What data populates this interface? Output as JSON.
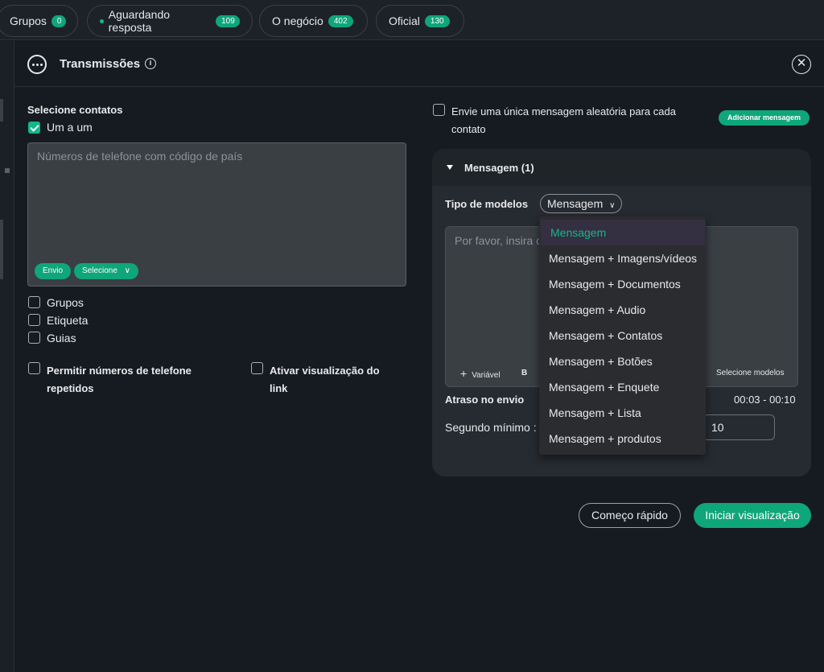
{
  "tabs": [
    {
      "label": "Grupos",
      "count": "0"
    },
    {
      "label": "Aguardando resposta",
      "count": "109"
    },
    {
      "label": "O negócio",
      "count": "402"
    },
    {
      "label": "Oficial",
      "count": "130"
    }
  ],
  "dialog": {
    "title": "Transmissões",
    "info_icon": "i",
    "close_icon": "✕"
  },
  "contacts": {
    "heading": "Selecione contatos",
    "one_by_one": "Um a um",
    "phone_placeholder": "Números de telefone com código de país",
    "send_pill": "Envio",
    "select_pill": "Selecione",
    "groups": "Grupos",
    "label": "Etiqueta",
    "guides": "Guias",
    "allow_repeated": "Permitir números de telefone repetidos",
    "enable_preview": "Ativar visualização do link"
  },
  "message": {
    "random_single": "Envie uma única mensagem aleatória para cada contato",
    "add_message": "Adicionar mensagem",
    "section_title": "Mensagem (1)",
    "model_type_label": "Tipo de modelos",
    "model_selected": "Mensagem",
    "editor_placeholder": "Por favor, insira o",
    "tool_variable": "Variável",
    "tool_bold": "B",
    "tool_select_models": "Selecione modelos",
    "delay_label": "Atraso no envio",
    "delay_range": "00:03 - 00:10",
    "min_seconds_label": "Segundo mínimo :",
    "max_value": "10"
  },
  "dropdown": {
    "options": [
      "Mensagem",
      "Mensagem + Imagens/vídeos",
      "Mensagem + Documentos",
      "Mensagem + Audio",
      "Mensagem + Contatos",
      "Mensagem + Botões",
      "Mensagem + Enquete",
      "Mensagem + Lista",
      "Mensagem + produtos"
    ]
  },
  "actions": {
    "quick_start": "Começo rápido",
    "start_preview": "Iniciar visualização"
  },
  "colors": {
    "accent": "#0fa67a",
    "background": "#161b21"
  }
}
